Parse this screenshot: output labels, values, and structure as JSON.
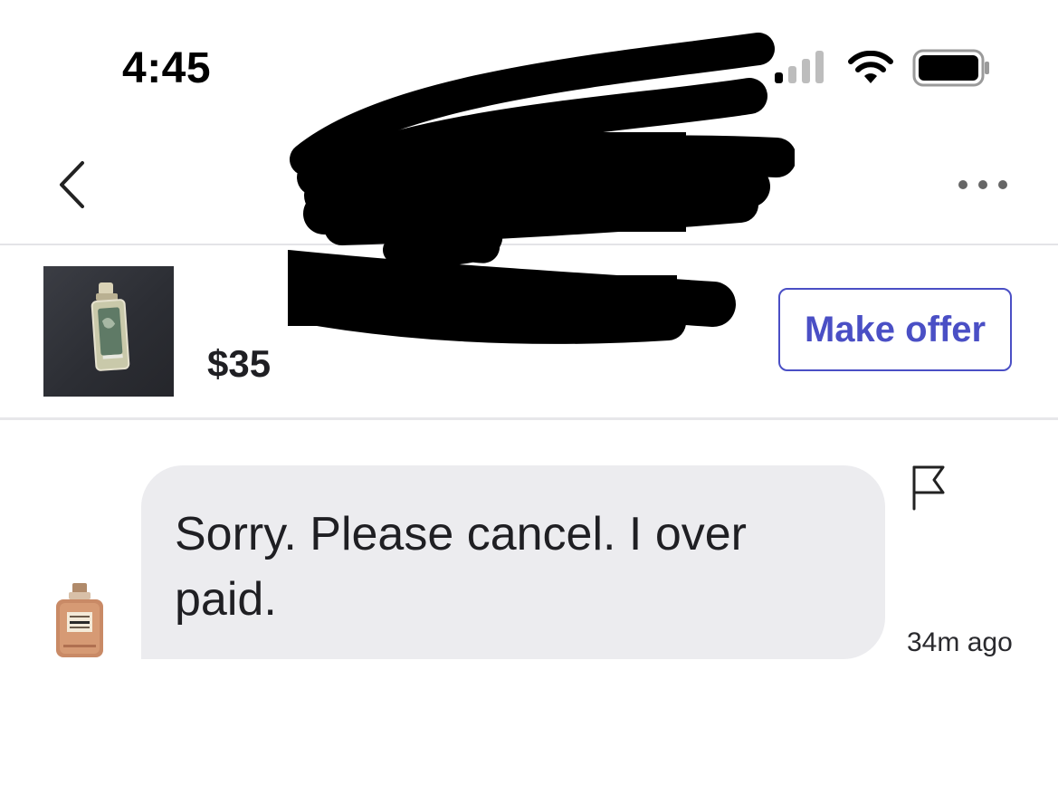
{
  "status_bar": {
    "time": "4:45",
    "signal_icon": "cellular-signal-icon",
    "wifi_icon": "wifi-icon",
    "battery_icon": "battery-icon"
  },
  "header": {
    "back_icon": "chevron-left-icon",
    "title": "",
    "more_icon": "more-horizontal-icon"
  },
  "listing": {
    "title": "",
    "price": "$35",
    "make_offer_label": "Make offer"
  },
  "conversation": {
    "messages": [
      {
        "text": "Sorry. Please cancel. I over\npaid.",
        "time": "34m ago"
      }
    ],
    "flag_icon": "flag-icon"
  },
  "colors": {
    "accent": "#4a4fc5",
    "bubble": "#ececef",
    "divider": "#e4e4e7"
  }
}
